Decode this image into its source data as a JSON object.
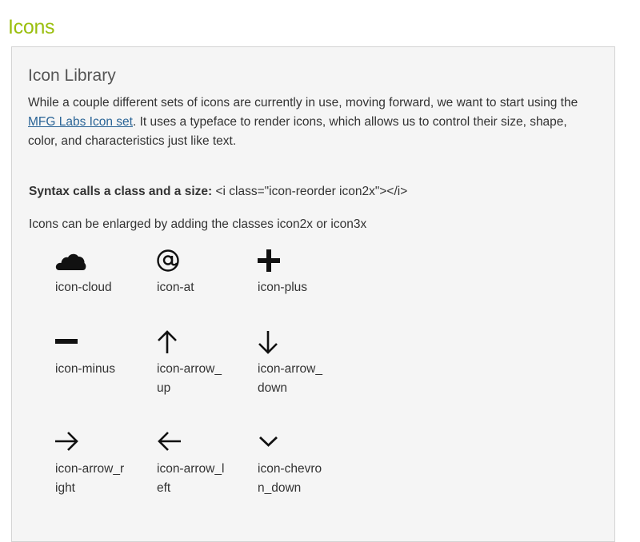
{
  "page": {
    "heading": "Icons"
  },
  "panel": {
    "title": "Icon Library",
    "intro_before_link": "While a couple different sets of icons are currently in use, moving forward, we want to start using the ",
    "intro_link": "MFG Labs Icon set",
    "intro_after_link": ". It uses a typeface to render icons, which allows us to control their size, shape, color, and characteristics just like text.",
    "syntax_label": "Syntax calls a class and a size:",
    "syntax_code": " <i class=\"icon-reorder icon2x\"></i>",
    "enlarge_text": "Icons can be enlarged by adding the classes icon2x or icon3x"
  },
  "icons": [
    {
      "name": "cloud-icon",
      "label": "icon-cloud"
    },
    {
      "name": "at-icon",
      "label": "icon-at"
    },
    {
      "name": "plus-icon",
      "label": "icon-plus"
    },
    {
      "name": "minus-icon",
      "label": "icon-minus"
    },
    {
      "name": "arrow-up-icon",
      "label": "icon-arrow_up"
    },
    {
      "name": "arrow-down-icon",
      "label": "icon-arrow_down"
    },
    {
      "name": "arrow-right-icon",
      "label": "icon-arrow_right"
    },
    {
      "name": "arrow-left-icon",
      "label": "icon-arrow_left"
    },
    {
      "name": "chevron-down-icon",
      "label": "icon-chevron_down"
    }
  ],
  "colors": {
    "heading": "#9bbf0f",
    "link": "#2a6496",
    "panel_background": "#f5f5f5"
  }
}
